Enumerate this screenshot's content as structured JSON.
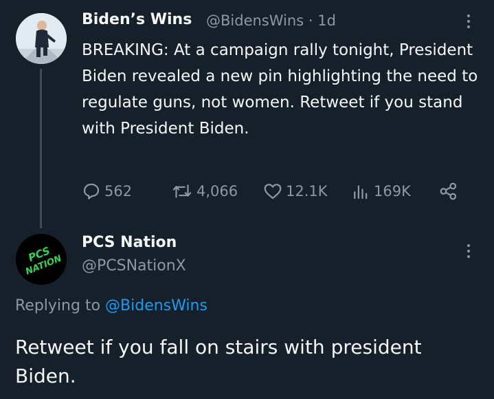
{
  "tweet": {
    "author_name": "Biden’s Wins",
    "author_handle": "@BidensWins",
    "separator": "·",
    "time": "1d",
    "text": "BREAKING: At a campaign rally tonight, President Biden revealed a new pin highlighting the need to regulate guns, not women. Retweet if you stand with President Biden.",
    "actions": {
      "replies": "562",
      "retweets": "4,066",
      "likes": "12.1K",
      "views": "169K"
    },
    "icons": [
      "reply-icon",
      "retweet-icon",
      "like-icon",
      "views-icon",
      "share-icon",
      "more-icon"
    ]
  },
  "reply": {
    "author_name": "PCS Nation",
    "author_handle": "@PCSNationX",
    "avatar_text": [
      "PCS",
      "NATION"
    ],
    "replying_prefix": "Replying to",
    "replying_to": "@BidensWins",
    "text": "Retweet if you fall on stairs with president Biden."
  },
  "colors": {
    "background": "#15202b",
    "text": "#f7f9f9",
    "muted": "#8b98a5",
    "link": "#1d9bf0",
    "logo_green": "#39d353"
  }
}
